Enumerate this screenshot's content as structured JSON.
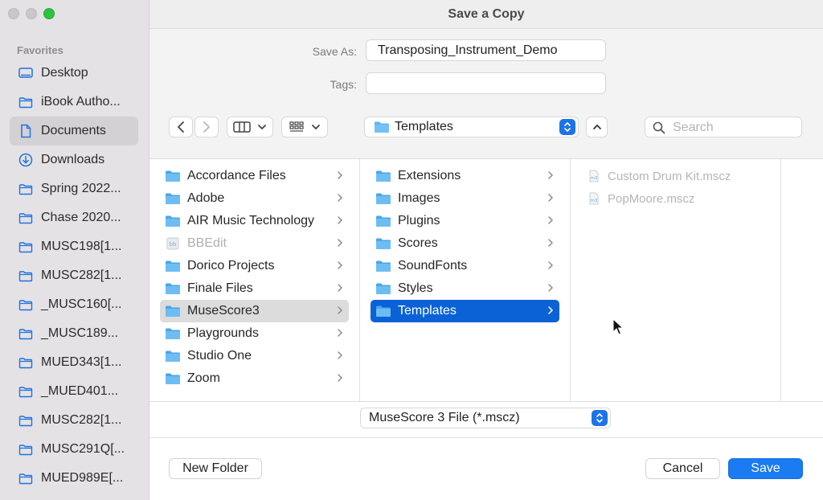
{
  "dialog": {
    "title": "Save a Copy",
    "save_as_label": "Save As:",
    "save_as_value": "Transposing_Instrument_Demo",
    "tags_label": "Tags:",
    "tags_value": ""
  },
  "sidebar": {
    "header": "Favorites",
    "items": [
      {
        "label": "Desktop",
        "icon": "desktop-icon"
      },
      {
        "label": "iBook Autho...",
        "icon": "folder-icon"
      },
      {
        "label": "Documents",
        "icon": "document-icon",
        "selected": true
      },
      {
        "label": "Downloads",
        "icon": "download-icon"
      },
      {
        "label": "Spring 2022...",
        "icon": "folder-icon"
      },
      {
        "label": "Chase 2020...",
        "icon": "folder-icon"
      },
      {
        "label": "MUSC198[1...",
        "icon": "folder-icon"
      },
      {
        "label": "MUSC282[1...",
        "icon": "folder-icon"
      },
      {
        "label": "_MUSC160[...",
        "icon": "folder-icon"
      },
      {
        "label": "_MUSC189...",
        "icon": "folder-icon"
      },
      {
        "label": "MUED343[1...",
        "icon": "folder-icon"
      },
      {
        "label": "_MUED401...",
        "icon": "folder-icon"
      },
      {
        "label": "MUSC282[1...",
        "icon": "folder-icon"
      },
      {
        "label": "MUSC291Q[...",
        "icon": "folder-icon"
      },
      {
        "label": "MUED989E[...",
        "icon": "folder-icon"
      }
    ]
  },
  "toolbar": {
    "location": "Templates",
    "search_placeholder": "Search"
  },
  "columns": {
    "col1": [
      {
        "label": "Accordance Files"
      },
      {
        "label": "Adobe"
      },
      {
        "label": "AIR Music Technology"
      },
      {
        "label": "BBEdit",
        "dim": true
      },
      {
        "label": "Dorico Projects"
      },
      {
        "label": "Finale Files"
      },
      {
        "label": "MuseScore3",
        "selected": true
      },
      {
        "label": "Playgrounds"
      },
      {
        "label": "Studio One"
      },
      {
        "label": "Zoom"
      }
    ],
    "col2": [
      {
        "label": "Extensions"
      },
      {
        "label": "Images"
      },
      {
        "label": "Plugins"
      },
      {
        "label": "Scores"
      },
      {
        "label": "SoundFonts"
      },
      {
        "label": "Styles"
      },
      {
        "label": "Templates",
        "selected": true
      }
    ],
    "col3": [
      {
        "label": "Custom Drum Kit.mscz"
      },
      {
        "label": "PopMoore.mscz"
      }
    ]
  },
  "footer": {
    "format": "MuseScore 3 File (*.mscz)",
    "new_folder": "New Folder",
    "cancel": "Cancel",
    "save": "Save"
  },
  "colors": {
    "accent": "#1a7bf2",
    "selection": "#0a62d6",
    "folder": "#5fb4f0"
  }
}
